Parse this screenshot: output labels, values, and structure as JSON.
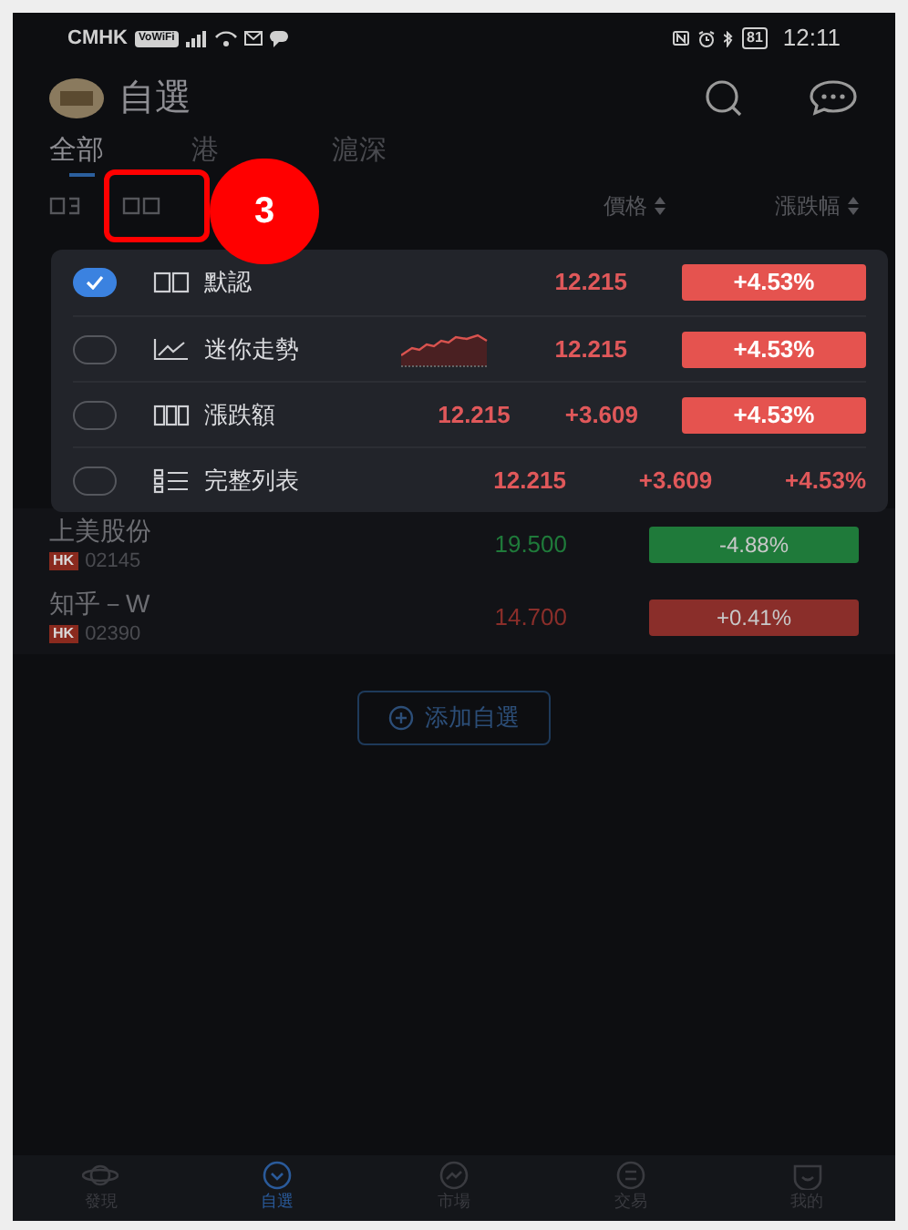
{
  "status_bar": {
    "carrier": "CMHK",
    "wifi_badge": "VoWiFi",
    "battery": "81",
    "time": "12:11"
  },
  "header": {
    "title": "自選"
  },
  "tabs": [
    {
      "label": "全部",
      "selected": true
    },
    {
      "label": "港",
      "selected": false
    },
    {
      "label": "滬深",
      "selected": false
    }
  ],
  "columns": {
    "price": "價格",
    "change": "漲跌幅"
  },
  "callout": {
    "number": "3"
  },
  "view_menu": [
    {
      "kind": "default",
      "label": "默認",
      "selected": true,
      "price": "12.215",
      "percent": "+4.53%"
    },
    {
      "kind": "mini",
      "label": "迷你走勢",
      "selected": false,
      "price": "12.215",
      "percent": "+4.53%"
    },
    {
      "kind": "change",
      "label": "漲跌額",
      "selected": false,
      "price": "12.215",
      "change": "+3.609",
      "percent": "+4.53%"
    },
    {
      "kind": "full",
      "label": "完整列表",
      "selected": false,
      "price": "12.215",
      "change": "+3.609",
      "percent": "+4.53%"
    }
  ],
  "stocks": [
    {
      "name": "上美股份",
      "market": "HK",
      "code": "02145",
      "price": "19.500",
      "percent": "-4.88%",
      "color": "#1f7a3a"
    },
    {
      "name": "知乎－W",
      "market": "HK",
      "code": "02390",
      "price": "14.700",
      "percent": "+0.41%",
      "color": "#8a2e2a"
    }
  ],
  "add_button": "添加自選",
  "bottom_nav": [
    {
      "label": "發現",
      "selected": false
    },
    {
      "label": "自選",
      "selected": true
    },
    {
      "label": "市場",
      "selected": false
    },
    {
      "label": "交易",
      "selected": false
    },
    {
      "label": "我的",
      "selected": false
    }
  ]
}
